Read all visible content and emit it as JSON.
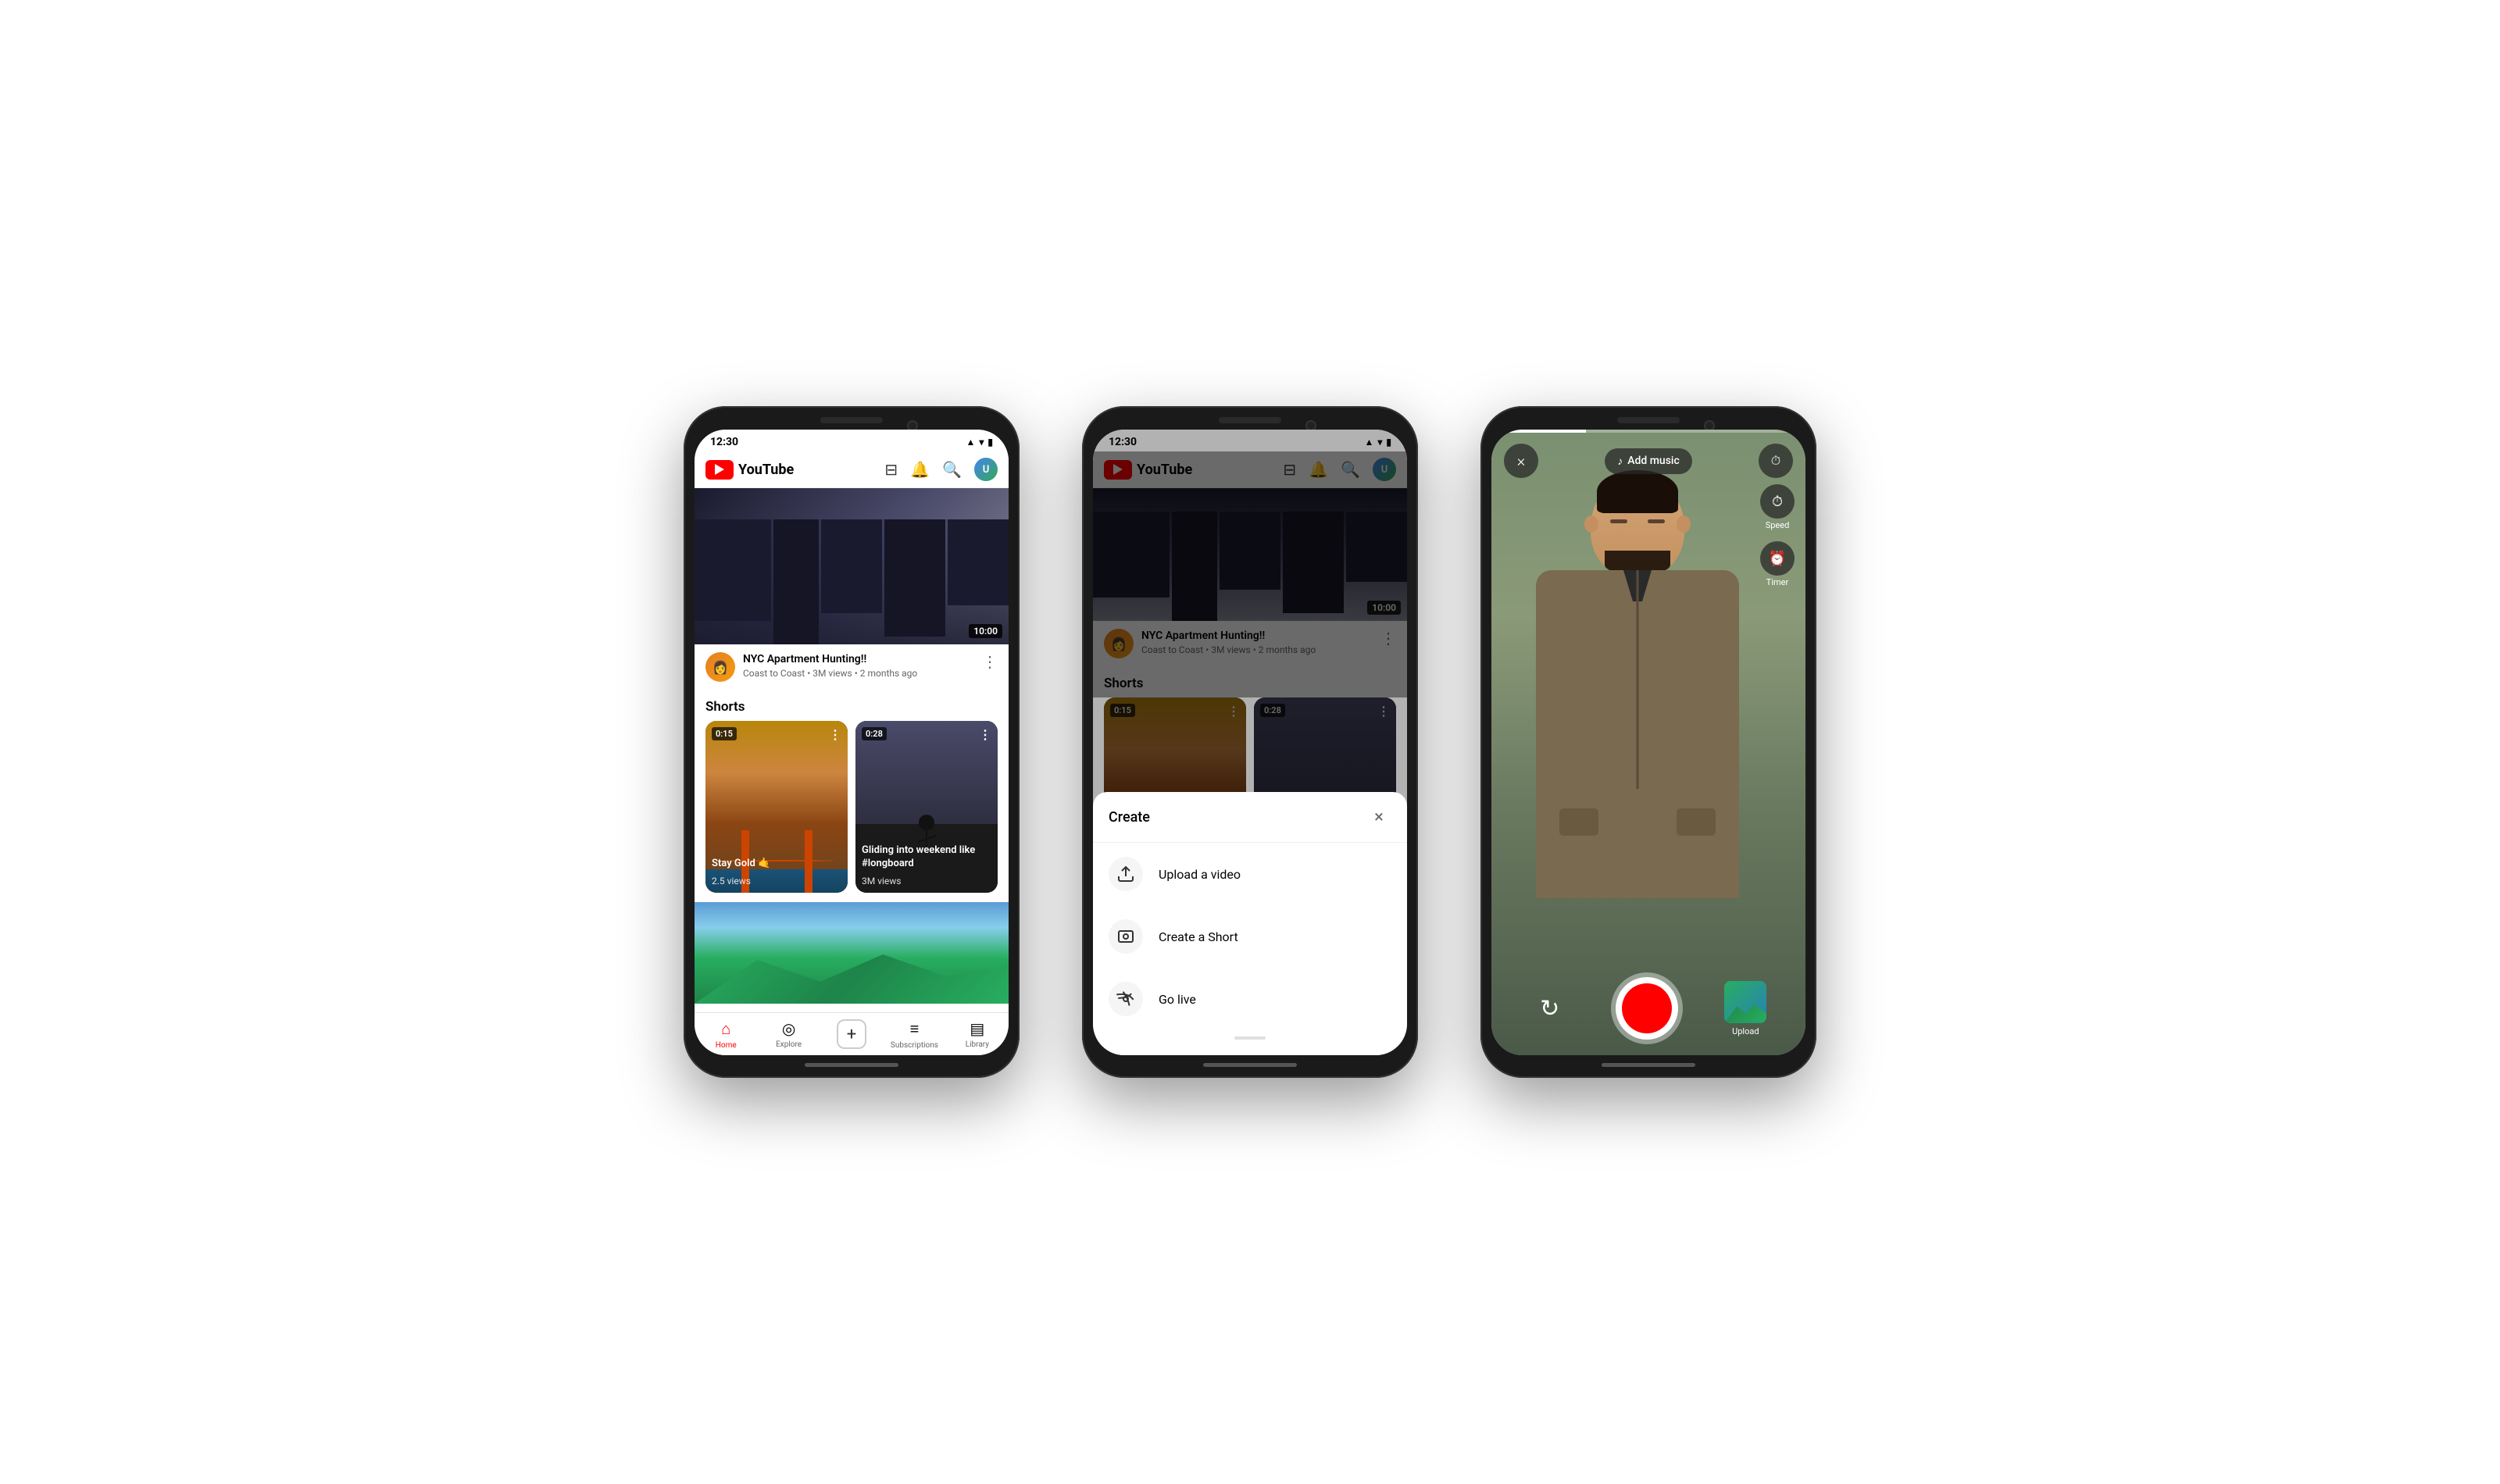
{
  "page": {
    "background": "#ffffff"
  },
  "phone1": {
    "status": {
      "time": "12:30",
      "signal": "▲",
      "wifi": "WiFi",
      "battery": "🔋"
    },
    "header": {
      "logo_text": "YouTube",
      "cast_icon": "cast",
      "bell_icon": "notifications",
      "search_icon": "search",
      "avatar_text": "U"
    },
    "video": {
      "duration": "10:00",
      "title": "NYC Apartment Hunting!!",
      "channel": "Coast to Coast",
      "meta": "3M views • 2 months ago"
    },
    "shorts_section": {
      "label": "Shorts",
      "short1": {
        "duration": "0:15",
        "title": "Stay Gold 🤙",
        "views": "2.5 views"
      },
      "short2": {
        "duration": "0:28",
        "title": "Gliding into weekend like #longboard",
        "views": "3M views"
      }
    },
    "nav": {
      "home": "Home",
      "explore": "Explore",
      "create": "+",
      "subscriptions": "Subscriptions",
      "library": "Library"
    }
  },
  "phone2": {
    "status": {
      "time": "12:30"
    },
    "create_modal": {
      "title": "Create",
      "close_icon": "×",
      "items": [
        {
          "icon": "upload",
          "label": "Upload a video"
        },
        {
          "icon": "camera",
          "label": "Create a Short"
        },
        {
          "icon": "live",
          "label": "Go live"
        }
      ]
    }
  },
  "phone3": {
    "camera": {
      "close_icon": "×",
      "add_music_label": "Add music",
      "speed_label": "Speed",
      "timer_label": "Timer",
      "upload_label": "Upload"
    }
  }
}
